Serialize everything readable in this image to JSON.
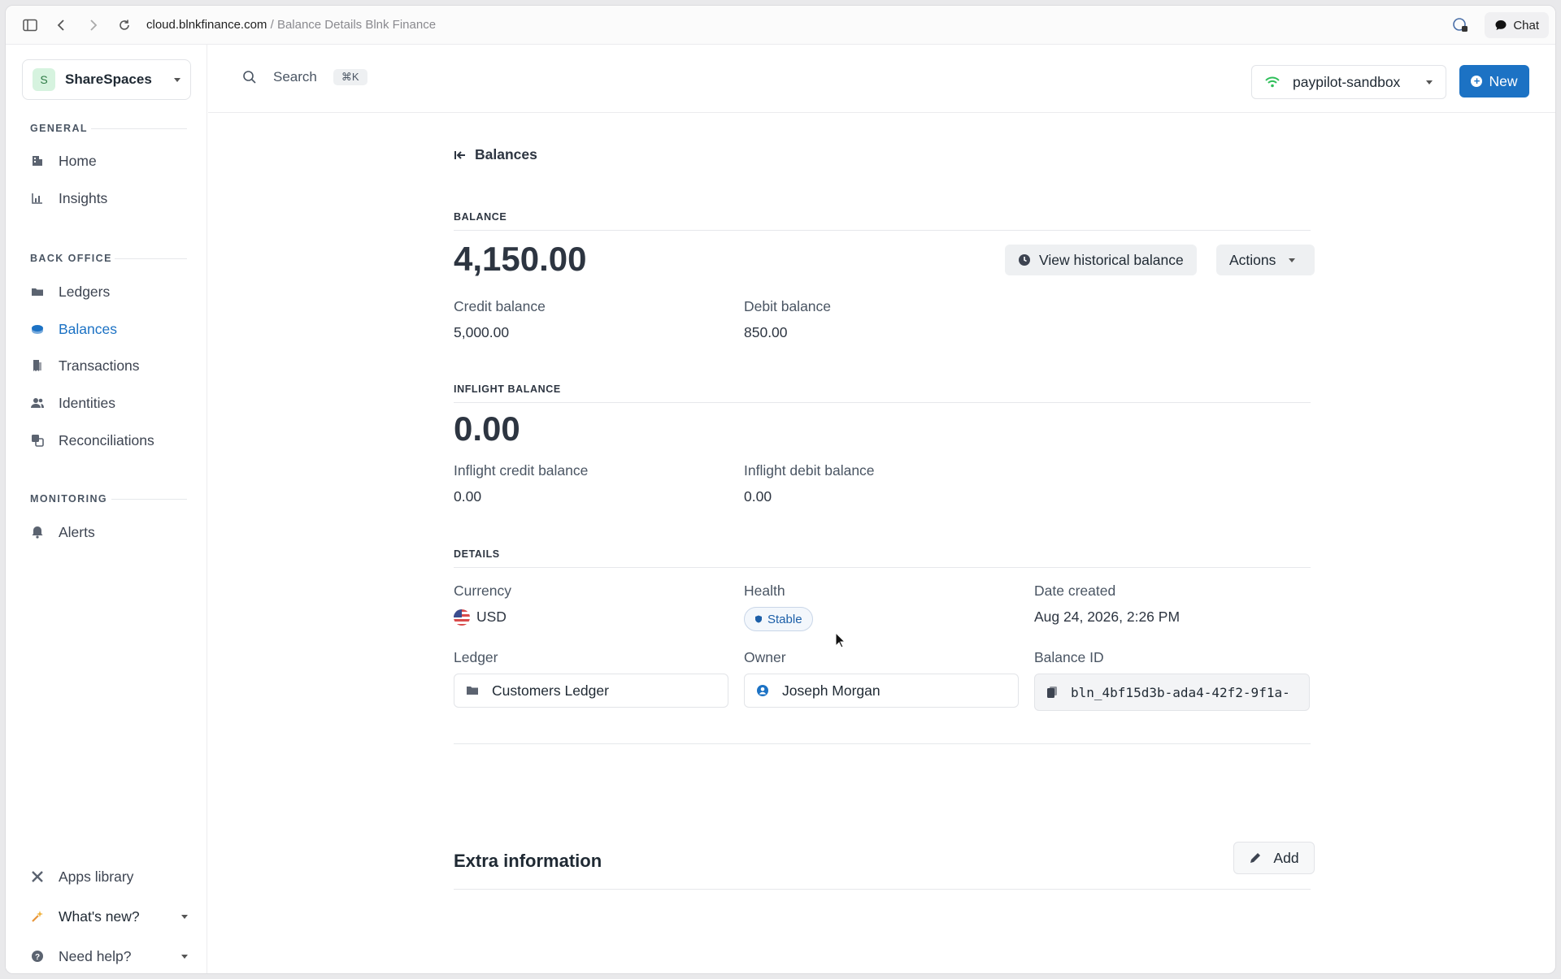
{
  "browser": {
    "url_domain": "cloud.blnkfinance.com",
    "url_separator": " / ",
    "url_page": "Balance Details Blnk Finance",
    "chat_label": "Chat"
  },
  "sidebar": {
    "workspace_initial": "S",
    "workspace_name": "ShareSpaces",
    "sections": {
      "general": "GENERAL",
      "back_office": "BACK OFFICE",
      "monitoring": "MONITORING"
    },
    "items": [
      {
        "label": "Home",
        "icon": "building-icon"
      },
      {
        "label": "Insights",
        "icon": "bar-chart-icon"
      },
      {
        "label": "Ledgers",
        "icon": "folder-icon"
      },
      {
        "label": "Balances",
        "icon": "coins-icon",
        "active": true
      },
      {
        "label": "Transactions",
        "icon": "receipt-icon"
      },
      {
        "label": "Identities",
        "icon": "users-icon"
      },
      {
        "label": "Reconciliations",
        "icon": "copy-icon"
      },
      {
        "label": "Alerts",
        "icon": "bell-icon"
      }
    ],
    "footer": {
      "apps_library": "Apps library",
      "whats_new": "What's new?",
      "need_help": "Need help?"
    }
  },
  "topbar": {
    "search_label": "Search",
    "search_shortcut": "⌘K",
    "environment": "paypilot-sandbox",
    "new_label": "New"
  },
  "main": {
    "back_label": "Balances",
    "balance_section": "BALANCE",
    "balance": "4,150.00",
    "view_historical_label": "View historical balance",
    "actions_label": "Actions",
    "credit_balance_label": "Credit balance",
    "credit_balance": "5,000.00",
    "debit_balance_label": "Debit balance",
    "debit_balance": "850.00",
    "inflight_section": "INFLIGHT BALANCE",
    "inflight_balance": "0.00",
    "inflight_credit_label": "Inflight credit balance",
    "inflight_credit": "0.00",
    "inflight_debit_label": "Inflight debit balance",
    "inflight_debit": "0.00",
    "details_section": "DETAILS",
    "currency_label": "Currency",
    "currency": "USD",
    "health_label": "Health",
    "health": "Stable",
    "date_created_label": "Date created",
    "date_created": "Aug 24, 2026, 2:26 PM",
    "ledger_label": "Ledger",
    "ledger": "Customers Ledger",
    "owner_label": "Owner",
    "owner": "Joseph Morgan",
    "balance_id_label": "Balance ID",
    "balance_id": "bln_4bf15d3b-ada4-42f2-9f1a-",
    "extra_info_title": "Extra information",
    "add_label": "Add"
  },
  "colors": {
    "accent": "#1c72c4",
    "text": "#1f2933",
    "muted": "#4a5563"
  }
}
